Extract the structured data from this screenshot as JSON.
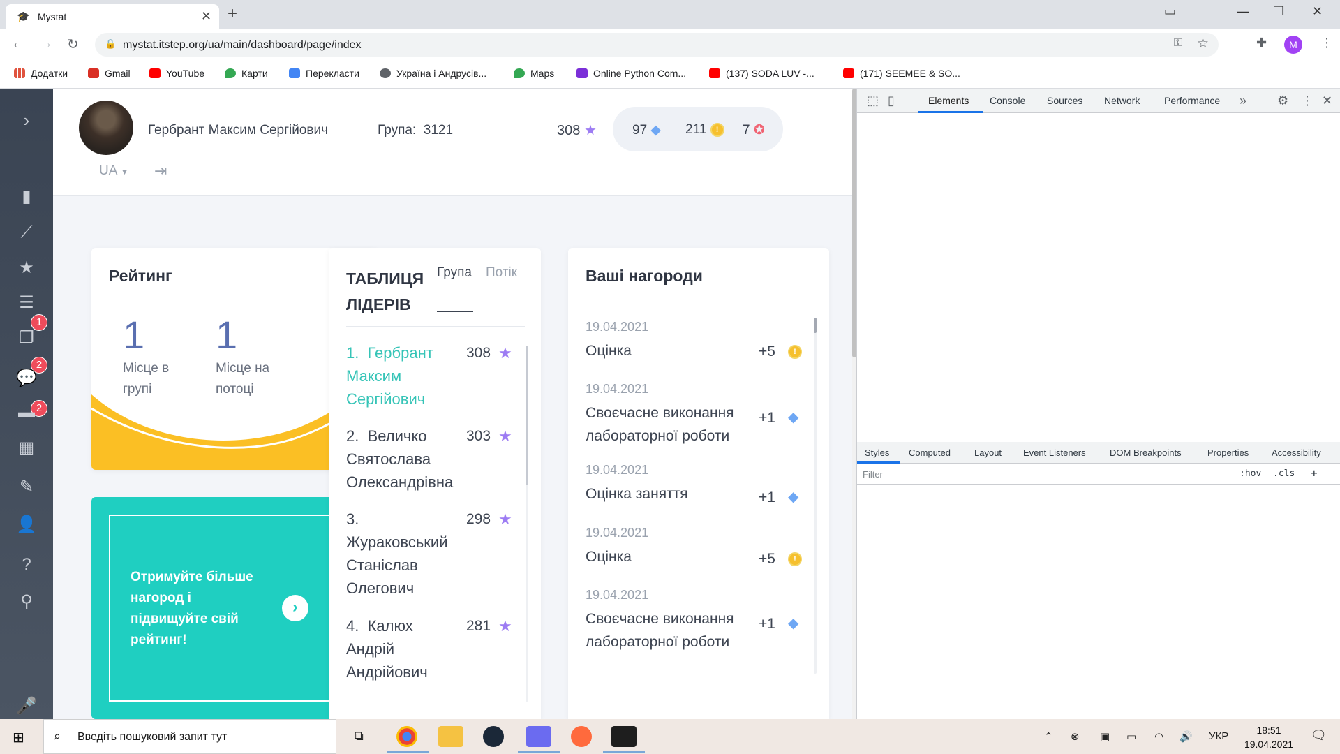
{
  "browser": {
    "tab_title": "Mystat",
    "url": "mystat.itstep.org/ua/main/dashboard/page/index",
    "profile_initial": "M",
    "bookmarks": [
      {
        "label": "Додатки",
        "icon": "apps-grid-icon",
        "color": "#e0533e"
      },
      {
        "label": "Gmail",
        "icon": "gmail-icon",
        "color": "#d93025"
      },
      {
        "label": "YouTube",
        "icon": "youtube-icon",
        "color": "#ff0000"
      },
      {
        "label": "Карти",
        "icon": "maps-pin-icon",
        "color": "#34a853"
      },
      {
        "label": "Перекласти",
        "icon": "translate-icon",
        "color": "#4285f4"
      },
      {
        "label": "Україна і Андрусів...",
        "icon": "globe-icon",
        "color": "#5f6368"
      },
      {
        "label": "Maps",
        "icon": "maps-pin-icon",
        "color": "#34a853"
      },
      {
        "label": "Online Python Com...",
        "icon": "python-icon",
        "color": "#7b2fd8"
      },
      {
        "label": "(137) SODA LUV -...",
        "icon": "youtube-icon",
        "color": "#ff0000"
      },
      {
        "label": "(171) SEEMEE & SO...",
        "icon": "youtube-icon",
        "color": "#ff0000"
      }
    ]
  },
  "sidebar": {
    "badges": {
      "news": "1",
      "homework": "2",
      "messages": "2"
    }
  },
  "header": {
    "user_name": "Гербрант Максим Сергійович",
    "group_label": "Група:",
    "group_value": "3121",
    "stars": "308",
    "gems": "97",
    "coins": "211",
    "badges": "7",
    "language": "UA"
  },
  "rating": {
    "title": "Рейтинг",
    "group_place": "1",
    "group_place_label": "Місце в групі",
    "stream_place": "1",
    "stream_place_label": "Місце на потоці"
  },
  "promo": {
    "text": "Отримуйте більше нагород і підвищуйте свій рейтинг!"
  },
  "leaders": {
    "title": "ТАБЛИЦЯ ЛІДЕРІВ",
    "tab_group": "Група",
    "tab_stream": "Потік",
    "rows": [
      {
        "rank": "1.",
        "name": "Гербрант Максим Сергійович",
        "points": "308"
      },
      {
        "rank": "2.",
        "name": "Величко Святослава Олександрівна",
        "points": "303"
      },
      {
        "rank": "3.",
        "name": "Жураковський Станіслав Олегович",
        "points": "298"
      },
      {
        "rank": "4.",
        "name": "Калюх Андрій Андрійович",
        "points": "281"
      }
    ]
  },
  "awards": {
    "title": "Ваші нагороди",
    "items": [
      {
        "date": "19.04.2021",
        "name": "Оцінка",
        "amount": "+5",
        "type": "coin"
      },
      {
        "date": "19.04.2021",
        "name": "Своєчасне виконання лабораторної роботи",
        "amount": "+1",
        "type": "gem"
      },
      {
        "date": "19.04.2021",
        "name": "Оцінка заняття",
        "amount": "+1",
        "type": "gem"
      },
      {
        "date": "19.04.2021",
        "name": "Оцінка",
        "amount": "+5",
        "type": "coin"
      },
      {
        "date": "19.04.2021",
        "name": "Своєчасне виконання лабораторної роботи",
        "amount": "+1",
        "type": "gem"
      }
    ]
  },
  "devtools": {
    "tabs": [
      "Elements",
      "Console",
      "Sources",
      "Network",
      "Performance"
    ],
    "sub_tabs": [
      "Styles",
      "Computed",
      "Layout",
      "Event Listeners",
      "DOM Breakpoints",
      "Properties",
      "Accessibility"
    ],
    "filter_placeholder": "Filter",
    "hov": ":hov",
    "cls": ".cls"
  },
  "taskbar": {
    "search_placeholder": "Введіть пошуковий запит тут",
    "language": "УКР",
    "time": "18:51",
    "date": "19.04.2021"
  },
  "colors": {
    "accent_teal": "#1fcfc1",
    "rating_number": "#5a6fb0",
    "star_purple": "#9d7cf3",
    "wave_yellow": "#fbbf24"
  }
}
